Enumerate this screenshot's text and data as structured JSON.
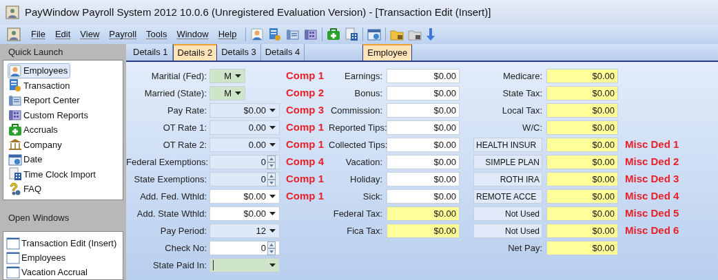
{
  "window": {
    "title": "PayWindow Payroll System 2012  10.0.6 (Unregistered Evaluation Version) - [Transaction Edit (Insert)]"
  },
  "menu": [
    "File",
    "Edit",
    "View",
    "Payroll",
    "Tools",
    "Window",
    "Help"
  ],
  "quick_launch": {
    "title": "Quick Launch",
    "items": [
      {
        "label": "Employees",
        "selected": true
      },
      {
        "label": "Transaction",
        "selected": false
      },
      {
        "label": "Report Center",
        "selected": false
      },
      {
        "label": "Custom Reports",
        "selected": false
      },
      {
        "label": "Accruals",
        "selected": false
      },
      {
        "label": "Company",
        "selected": false
      },
      {
        "label": "Date",
        "selected": false
      },
      {
        "label": "Time Clock Import",
        "selected": false
      },
      {
        "label": "FAQ",
        "selected": false
      }
    ]
  },
  "open_windows": {
    "title": "Open Windows",
    "items": [
      "Transaction Edit (Insert)",
      "Employees",
      "Vacation Accrual"
    ]
  },
  "tabs": [
    {
      "label": "Details 1",
      "selected": false
    },
    {
      "label": "Details 2",
      "selected": true
    },
    {
      "label": "Details 3",
      "selected": false
    },
    {
      "label": "Details 4",
      "selected": false
    },
    {
      "label": "Employee",
      "selected": true
    }
  ],
  "left_fields": [
    {
      "label": "Maritial (Fed):",
      "value": "M",
      "kind": "dropdown",
      "color": "#cfe5c9"
    },
    {
      "label": "Married (State):",
      "value": "M",
      "kind": "dropdown",
      "color": "#cfe5c9"
    },
    {
      "label": "Pay Rate:",
      "value": "$0.00",
      "kind": "dropdown",
      "color": "#dde9f8"
    },
    {
      "label": "OT Rate 1:",
      "value": "0.00",
      "kind": "dropdown",
      "color": "#dde9f8"
    },
    {
      "label": "OT Rate 2:",
      "value": "0.00",
      "kind": "dropdown",
      "color": "#dde9f8"
    },
    {
      "label": "Federal Exemptions:",
      "value": "0",
      "kind": "spinner",
      "color": "#dde9f8"
    },
    {
      "label": "State Exemptions:",
      "value": "0",
      "kind": "spinner",
      "color": "#dde9f8"
    },
    {
      "label": "Add. Fed. Wthld:",
      "value": "$0.00",
      "kind": "dropdown",
      "color": "#ffffff"
    },
    {
      "label": "Add. State Wthld:",
      "value": "$0.00",
      "kind": "dropdown",
      "color": "#ffffff"
    },
    {
      "label": "Pay Period:",
      "value": "12",
      "kind": "dropdown",
      "color": "#dde9f8"
    },
    {
      "label": "Check No:",
      "value": "0",
      "kind": "spinner",
      "color": "#ffffff"
    },
    {
      "label": "State Paid In:",
      "kind": "dropdown",
      "color": "#cfe5c9",
      "focused": true
    }
  ],
  "middle_fields": [
    {
      "note": "Comp 1",
      "label": "Earnings:",
      "value": "$0.00",
      "color": "#ffffff"
    },
    {
      "note": "Comp 2",
      "label": "Bonus:",
      "value": "$0.00",
      "color": "#ffffff"
    },
    {
      "note": "Comp 3",
      "label": "Commission:",
      "value": "$0.00",
      "color": "#ffffff"
    },
    {
      "note": "Comp 1",
      "label": "Reported Tips:",
      "value": "$0.00",
      "color": "#ffffff"
    },
    {
      "note": "Comp 1",
      "label": "Collected Tips:",
      "value": "$0.00",
      "color": "#ffffff"
    },
    {
      "note": "Comp 4",
      "label": "Vacation:",
      "value": "$0.00",
      "color": "#ffffff"
    },
    {
      "note": "Comp 1",
      "label": "Holiday:",
      "value": "$0.00",
      "color": "#ffffff"
    },
    {
      "note": "Comp 1",
      "label": "Sick:",
      "value": "$0.00",
      "color": "#ffffff"
    },
    {
      "label": "Federal Tax:",
      "value": "$0.00",
      "color": "#ffff99"
    },
    {
      "label": "Fica Tax:",
      "value": "$0.00",
      "color": "#ffff99"
    }
  ],
  "right_fields": [
    {
      "kind": "label",
      "label": "Medicare:",
      "value": "$0.00"
    },
    {
      "kind": "label",
      "label": "State Tax:",
      "value": "$0.00"
    },
    {
      "kind": "label",
      "label": "Local Tax:",
      "value": "$0.00"
    },
    {
      "kind": "label",
      "label": "W/C:",
      "value": "$0.00"
    },
    {
      "kind": "named",
      "label": "HEALTH INSUR",
      "value": "$0.00",
      "note": "Misc Ded 1"
    },
    {
      "kind": "named",
      "label": "SIMPLE PLAN",
      "value": "$0.00",
      "note": "Misc Ded 2"
    },
    {
      "kind": "named",
      "label": "ROTH IRA",
      "value": "$0.00",
      "note": "Misc Ded 3"
    },
    {
      "kind": "named",
      "label": "REMOTE ACCE",
      "value": "$0.00",
      "note": "Misc Ded 4"
    },
    {
      "kind": "named",
      "label": "Not Used",
      "value": "$0.00",
      "note": "Misc Ded 5"
    },
    {
      "kind": "named",
      "label": "Not Used",
      "value": "$0.00",
      "note": "Misc Ded 6"
    },
    {
      "kind": "label",
      "label": "Net Pay:",
      "value": "$0.00"
    }
  ]
}
